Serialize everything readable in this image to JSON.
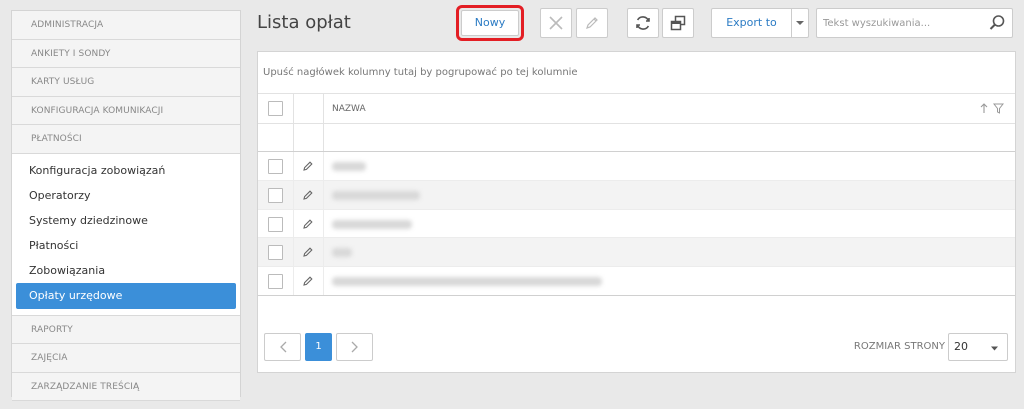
{
  "sidebar": {
    "sections_top": [
      "ADMINISTRACJA",
      "ANKIETY I SONDY",
      "KARTY USŁUG",
      "KONFIGURACJA KOMUNIKACJI",
      "PŁATNOŚCI"
    ],
    "submenu": [
      "Konfiguracja zobowiązań",
      "Operatorzy",
      "Systemy dziedzinowe",
      "Płatności",
      "Zobowiązania",
      "Opłaty urzędowe"
    ],
    "active_item": "Opłaty urzędowe",
    "sections_bottom": [
      "RAPORTY",
      "ZAJĘCIA",
      "ZARZĄDZANIE TREŚCIĄ"
    ]
  },
  "header": {
    "title": "Lista opłat",
    "new_button": "Nowy",
    "export_button": "Export to",
    "search_placeholder": "Tekst wyszukiwania..."
  },
  "grid": {
    "group_hint": "Upuść nagłówek kolumny tutaj by pogrupować po tej kolumnie",
    "column_name": "NAZWA",
    "row_count": 5
  },
  "pager": {
    "current_page": "1",
    "page_size_label": "ROZMIAR STRONY",
    "page_size": "20"
  },
  "colors": {
    "accent": "#3b8fd9",
    "highlight": "#e31e24",
    "link": "#2b7bc4"
  }
}
